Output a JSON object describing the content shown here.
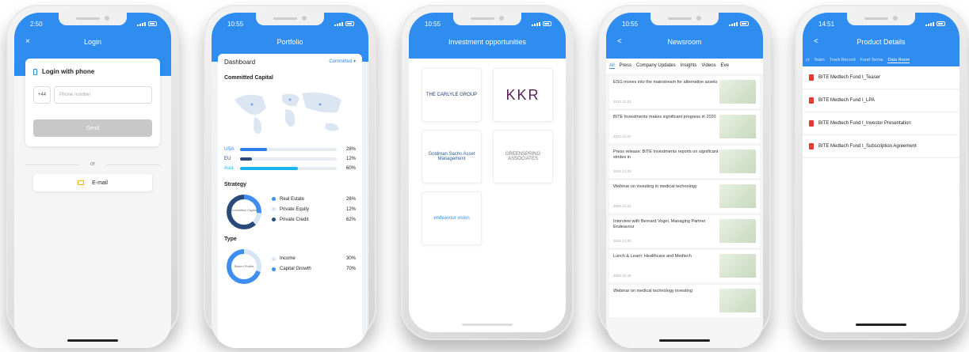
{
  "login": {
    "time": "2:50",
    "close": "×",
    "title": "Login",
    "method": "Login with phone",
    "country_code": "+44",
    "phone_placeholder": "Phone number",
    "send": "Send",
    "or": "or",
    "email": "E-mail"
  },
  "portfolio": {
    "time": "10:55",
    "title": "Portfolio",
    "dashboard": "Dashboard",
    "filter": "Committed ▾",
    "committed_title": "Committed Capital",
    "regions": [
      {
        "label": "USA",
        "pct": "28%",
        "value": 28,
        "color": "#2f7fe8"
      },
      {
        "label": "EU",
        "pct": "12%",
        "value": 12,
        "color": "#2a4a7a"
      },
      {
        "label": "Asia",
        "pct": "60%",
        "value": 60,
        "color": "#19b5f0"
      }
    ],
    "strategy_title": "Strategy",
    "strategy_center": "Committed Capital",
    "strategy": [
      {
        "label": "Real Estate",
        "pct": "26%",
        "value": 26,
        "color": "#3d8ef0"
      },
      {
        "label": "Private Equity",
        "pct": "12%",
        "value": 12,
        "color": "#d6e6f6"
      },
      {
        "label": "Private Credit",
        "pct": "62%",
        "value": 62,
        "color": "#2a4a7a"
      }
    ],
    "type_title": "Type",
    "type_center": "Return Profile",
    "type": [
      {
        "label": "Income",
        "pct": "30%",
        "value": 30,
        "color": "#d6e6f6"
      },
      {
        "label": "Capital Growth",
        "pct": "70%",
        "value": 70,
        "color": "#3d8ef0"
      }
    ]
  },
  "investments": {
    "time": "10:55",
    "title": "Investment opportunities",
    "logos": [
      {
        "text": "THE CARLYLE GROUP",
        "color": "#1c3a6e"
      },
      {
        "text": "KKR",
        "color": "#5b1f57"
      },
      {
        "text": "Goldman Sachs Asset Management",
        "color": "#2a5fa0"
      },
      {
        "text": "GREENSPRING ASSOCIATES",
        "color": "#777"
      },
      {
        "text": "endeavour vision",
        "color": "#2f8df0"
      }
    ]
  },
  "newsroom": {
    "time": "10:55",
    "back": "<",
    "title": "Newsroom",
    "tabs": [
      "All",
      "Press",
      "Company Updates",
      "Insights",
      "Videos",
      "Eve"
    ],
    "items": [
      {
        "text": "ESG moves into the mainstream for alternative assets",
        "date": "2021.01.13"
      },
      {
        "text": "BITE Investments makes significant progress in 2020",
        "date": "2021.01.07"
      },
      {
        "text": "Press release: BITE Investments reports on significant strides in",
        "date": "2020.12.18"
      },
      {
        "text": "Webinar on investing in medical technology",
        "date": "2020.12.15"
      },
      {
        "text": "Interview with Bernard Vogel, Managing Partner Endeavour",
        "date": "2020.12.10"
      },
      {
        "text": "Lunch & Learn: Healthcare and Medtech",
        "date": "2020.12.03"
      },
      {
        "text": "Webinar on medical technology investing",
        "date": ""
      }
    ]
  },
  "product": {
    "time": "14:51",
    "back": "<",
    "title": "Product Details",
    "tabs": [
      "ct",
      "Team",
      "Track Record",
      "Fund Terms",
      "Data Room"
    ],
    "docs": [
      "BITE Medtech Fund I_Teaser",
      "BITE Medtech Fund I_LPA",
      "BITE Medtech Fund I_Investor Presentation",
      "BITE Medtech Fund I_Subscription Agreement"
    ]
  }
}
